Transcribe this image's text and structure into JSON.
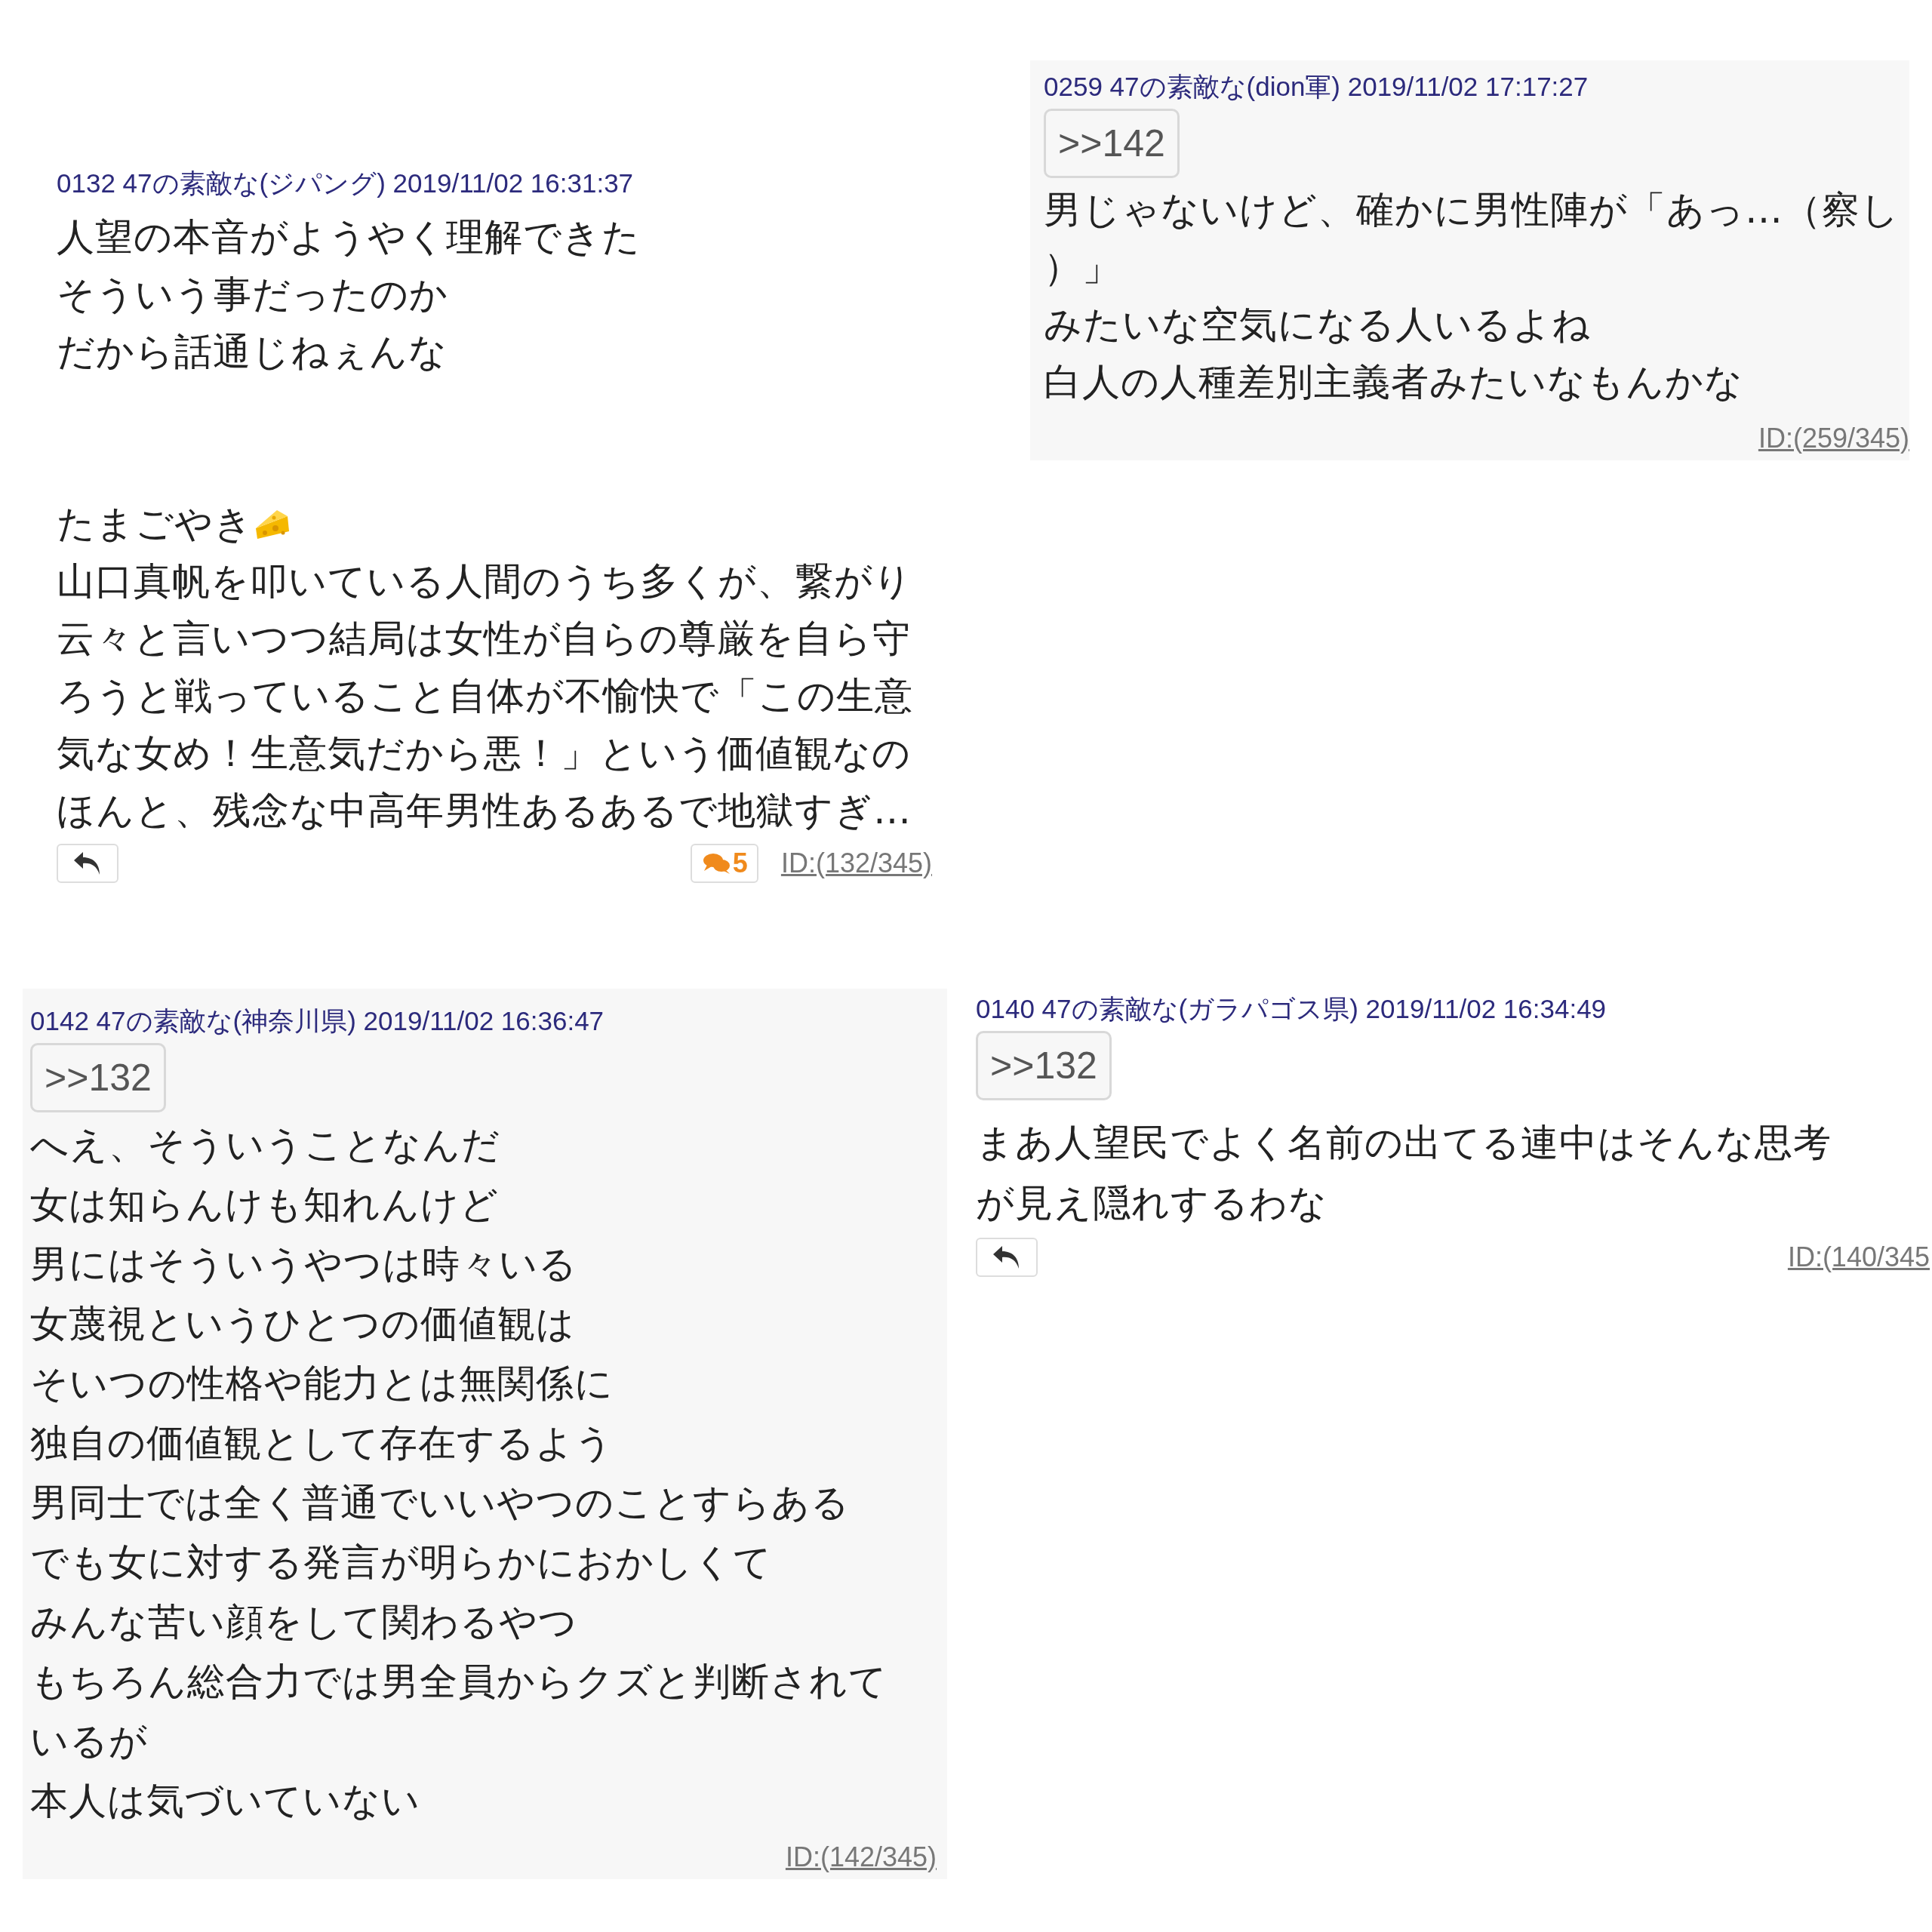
{
  "posts": [
    {
      "header": "0132 47の素敵な(ジパング) 2019/11/02 16:31:37",
      "shaded": false,
      "paragraphs": [
        [
          "人望の本音がようやく理解できた",
          "そういう事だったのか",
          "だから話通じねぇんな"
        ],
        [
          {
            "text": "たまごやき",
            "kind": "with-icon"
          },
          "山口真帆を叩いている人間のうち多くが、繋がり",
          "云々と言いつつ結局は女性が自らの尊厳を自ら守",
          "ろうと戦っていること自体が不愉快で「この生意",
          "気な女め！生意気だから悪！」という価値観なの",
          "ほんと、残念な中高年男性あるあるで地獄すぎ…"
        ]
      ],
      "reply_button": true,
      "comments": "5",
      "id_link": "ID:(132/345)"
    },
    {
      "header": "0259 47の素敵な(dion軍) 2019/11/02 17:17:27",
      "shaded": true,
      "quote": ">>142",
      "paragraphs": [
        [
          "男じゃないけど、確かに男性陣が「あっ…（察し",
          "）」",
          "みたいな空気になる人いるよね",
          "白人の人種差別主義者みたいなもんかな"
        ]
      ],
      "reply_button": false,
      "id_link": "ID:(259/345)"
    },
    {
      "header": "0142 47の素敵な(神奈川県) 2019/11/02 16:36:47",
      "shaded": true,
      "quote": ">>132",
      "paragraphs": [
        [
          "へえ、そういうことなんだ",
          "女は知らんけも知れんけど",
          "男にはそういうやつは時々いる",
          "女蔑視というひとつの価値観は",
          "そいつの性格や能力とは無関係に",
          "独自の価値観として存在するよう",
          "男同士では全く普通でいいやつのことすらある",
          "でも女に対する発言が明らかにおかしくて",
          "みんな苦い顔をして関わるやつ",
          "もちろん総合力では男全員からクズと判断されて",
          "いるが",
          "本人は気づいていない"
        ]
      ],
      "reply_button": false,
      "id_link": "ID:(142/345)"
    },
    {
      "header": "0140 47の素敵な(ガラパゴス県) 2019/11/02 16:34:49",
      "shaded": false,
      "quote": ">>132",
      "paragraphs": [
        [
          "まあ人望民でよく名前の出てる連中はそんな思考",
          "が見え隠れするわな"
        ]
      ],
      "reply_button": true,
      "id_link": "ID:(140/345"
    }
  ]
}
